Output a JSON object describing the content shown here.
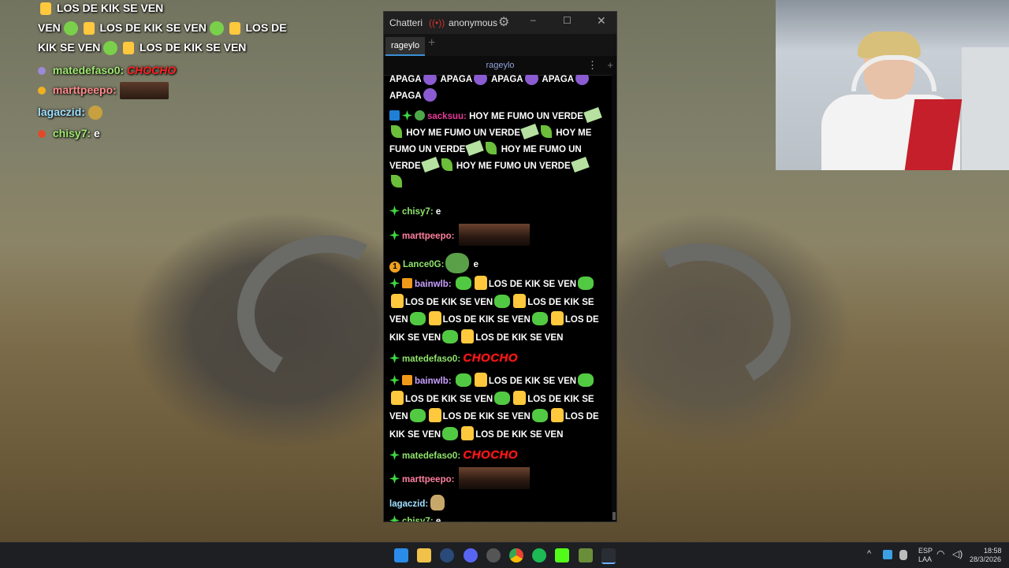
{
  "overlay": {
    "lines": [
      {
        "text": "LOS DE KIK SE VEN"
      },
      {
        "text": "VEN"
      },
      {
        "text": "LOS DE KIK SE VEN"
      },
      {
        "text": "LOS DE"
      },
      {
        "text": "KIK SE VEN"
      },
      {
        "text": "LOS DE KIK SE VEN"
      }
    ],
    "matedefaso_user": "matedefaso0:",
    "matedefaso_msg": "CHOCHO",
    "marttpeepo_user": "marttpeepo:",
    "lagaczid_user": "lagaczid:",
    "chisy_user": "chisy7:",
    "chisy_msg": "e"
  },
  "window": {
    "title": "Chatterino",
    "title_short": "Chatteri",
    "account": "anonymous",
    "tab": "rageylo",
    "channel": "rageylo",
    "add_tab": "+",
    "menu": "⋮",
    "plus": "+"
  },
  "chat": {
    "m0": {
      "text1": "APAGA",
      "text2": "APAGA",
      "text3": "APAGA",
      "text4": "APAGA",
      "text5": "APAGA"
    },
    "m1": {
      "user": "sacksuu",
      "t1": "HOY ME FUMO UN VERDE",
      "t2": "HOY ME FUMO UN VERDE",
      "t3": "HOY ME",
      "t4": "FUMO UN VERDE",
      "t5": "HOY ME FUMO UN",
      "t6": "VERDE",
      "t7": "HOY ME FUMO UN VERDE"
    },
    "m2": {
      "user": "chisy7",
      "text": "e"
    },
    "m3": {
      "user": "marttpeepo"
    },
    "m4": {
      "user": "Lance0G",
      "text": "e",
      "badge": "1"
    },
    "m5": {
      "user": "bainwlb",
      "t1": "LOS DE KIK SE VEN",
      "t2": "LOS DE KIK SE VEN",
      "t3": "LOS DE KIK SE",
      "t4": "VEN",
      "t5": "LOS DE KIK SE VEN",
      "t6": "LOS DE",
      "t7": "KIK SE VEN",
      "t8": "LOS DE KIK SE VEN"
    },
    "m6": {
      "user": "matedefaso0",
      "text": "CHOCHO"
    },
    "m7": {
      "user": "bainwlb",
      "t1": "LOS DE KIK SE VEN",
      "t2": "LOS DE KIK SE VEN",
      "t3": "LOS DE KIK SE",
      "t4": "VEN",
      "t5": "LOS DE KIK SE VEN",
      "t6": "LOS DE",
      "t7": "KIK SE VEN",
      "t8": "LOS DE KIK SE VEN"
    },
    "m8": {
      "user": "matedefaso0",
      "text": "CHOCHO"
    },
    "m9": {
      "user": "marttpeepo"
    },
    "m10": {
      "user": "lagaczid"
    },
    "m11": {
      "user": "chisy7",
      "text": "e"
    }
  },
  "taskbar": {
    "lang1": "ESP",
    "lang2": "LAA",
    "time": "18:58",
    "date": "28/3/2026",
    "chevron": "^"
  },
  "colors": {
    "accent": "#3a8fd6",
    "username_green": "#7ce05b",
    "chocho_red": "#ff1a1a",
    "chat_bg": "#000000"
  }
}
